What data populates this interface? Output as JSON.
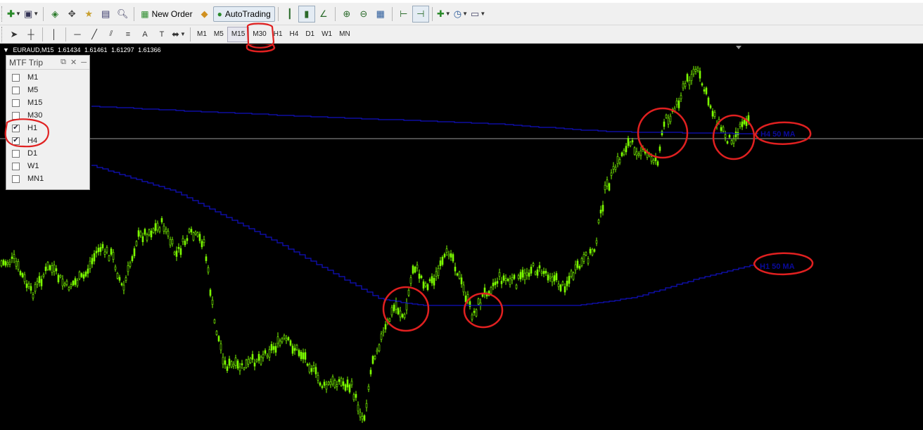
{
  "toolbar_top": {
    "new_order_label": "New Order",
    "autotrading_label": "AutoTrading"
  },
  "timeframes": [
    "M1",
    "M5",
    "M15",
    "M30",
    "H1",
    "H4",
    "D1",
    "W1",
    "MN"
  ],
  "active_timeframe": "M15",
  "chart": {
    "title_symbol": "EURAUD,M15",
    "title_prices": [
      "1.61434",
      "1.61461",
      "1.61297",
      "1.61366"
    ],
    "background": "#000000",
    "candle_color": "#7CFC00",
    "ma_color": "#1010C0",
    "annotation_color": "#E02020"
  },
  "mtf_panel": {
    "title": "MTF Trip",
    "items": [
      {
        "label": "M1",
        "checked": false
      },
      {
        "label": "M5",
        "checked": false
      },
      {
        "label": "M15",
        "checked": false
      },
      {
        "label": "M30",
        "checked": false
      },
      {
        "label": "H1",
        "checked": true
      },
      {
        "label": "H4",
        "checked": true
      },
      {
        "label": "D1",
        "checked": false
      },
      {
        "label": "W1",
        "checked": false
      },
      {
        "label": "MN1",
        "checked": false
      }
    ]
  },
  "ma_labels": {
    "h4": "H4 50 MA",
    "h1": "H1 50 MA"
  }
}
